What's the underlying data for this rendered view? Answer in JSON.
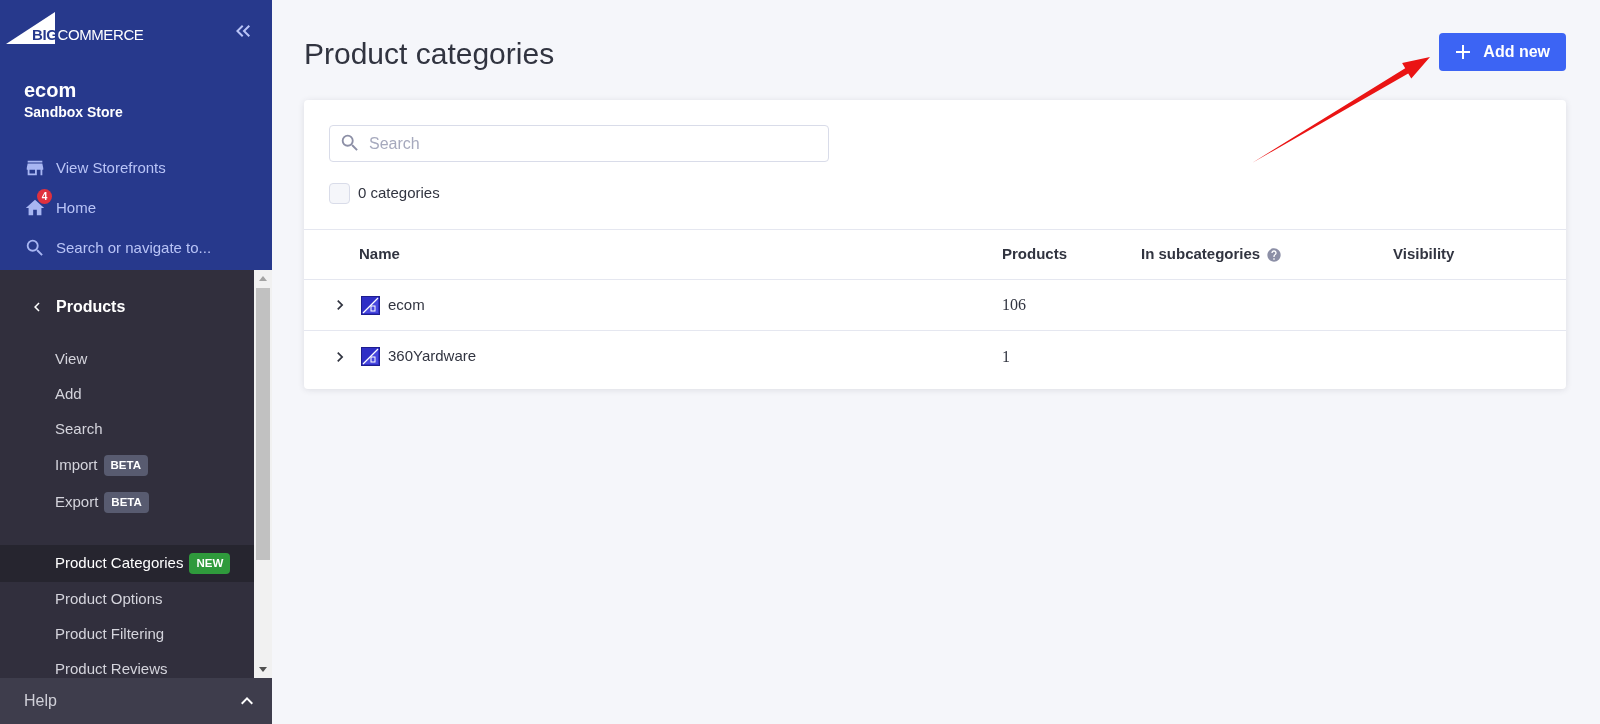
{
  "sidebar": {
    "logo": {
      "mark": "BIG",
      "text": "COMMERCE"
    },
    "store": {
      "name": "ecom",
      "subtitle": "Sandbox Store"
    },
    "links": [
      {
        "kind": "storefront",
        "label": "View Storefronts"
      },
      {
        "kind": "home",
        "label": "Home",
        "badge": "4"
      },
      {
        "kind": "search",
        "label": "Search or navigate to..."
      }
    ],
    "section": {
      "title": "Products"
    },
    "item_groups": [
      {
        "items": [
          {
            "label": "View",
            "selected": false
          },
          {
            "label": "Add",
            "selected": false
          },
          {
            "label": "Search",
            "selected": false
          },
          {
            "label": "Import",
            "selected": false,
            "badge": {
              "kind": "beta",
              "label": "BETA"
            }
          },
          {
            "label": "Export",
            "selected": false,
            "badge": {
              "kind": "beta",
              "label": "BETA"
            }
          }
        ]
      },
      {
        "items": [
          {
            "label": "Product Categories",
            "selected": true,
            "badge": {
              "kind": "new",
              "label": "NEW"
            }
          },
          {
            "label": "Product Options",
            "selected": false
          },
          {
            "label": "Product Filtering",
            "selected": false
          },
          {
            "label": "Product Reviews",
            "selected": false
          }
        ]
      }
    ],
    "help": {
      "label": "Help"
    }
  },
  "page": {
    "title": "Product categories",
    "add_button": {
      "label": "Add new"
    }
  },
  "card": {
    "search": {
      "placeholder": "Search"
    },
    "select_all": {
      "checked": false,
      "label": "0 categories"
    },
    "table": {
      "columns": [
        {
          "kind": "plain",
          "label": "Name"
        },
        {
          "kind": "plain",
          "label": "Products"
        },
        {
          "kind": "with_help",
          "label": "In subcategories"
        },
        {
          "kind": "plain",
          "label": "Visibility"
        }
      ],
      "rows": [
        {
          "name": "ecom",
          "products": "106",
          "expanded": false
        },
        {
          "name": "360Yardware",
          "products": "1",
          "expanded": false
        }
      ]
    }
  }
}
